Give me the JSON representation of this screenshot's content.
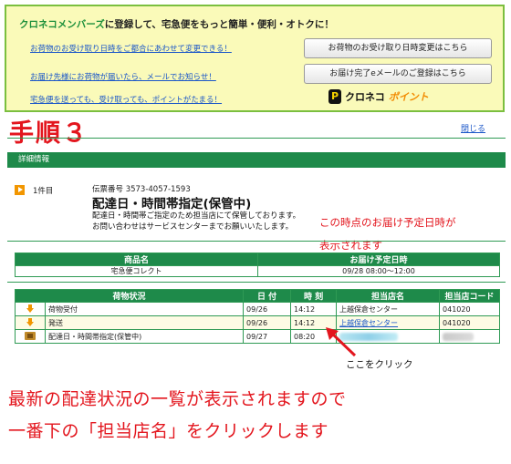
{
  "promo": {
    "heading_brand": "クロネコメンバーズ",
    "heading_rest": "に登録して、宅急便をもっと簡単・便利・オトクに！",
    "links": [
      "お荷物のお受け取り日時をご都合にあわせて変更できる！",
      "お届け先様にお荷物が届いたら、メールでお知らせ！",
      "宅急便を送っても、受け取っても、ポイントがたまる！"
    ],
    "buttons": [
      "お荷物のお受け取り日時変更はこちら",
      "お届け完了eメールのご登録はこちら"
    ],
    "logo_badge": "P",
    "logo_text": "クロネコ",
    "logo_point": "ポイント"
  },
  "step_title": "手順３",
  "close_link": "閉じる",
  "detail_header": "詳細情報",
  "item": {
    "count": "1件目",
    "slip": "伝票番号 3573-4057-1593",
    "status": "配達日・時間帯指定(保管中)",
    "note1": "配達日・時間帯ご指定のため担当店にて保管しております。",
    "note2": "お問い合わせはサービスセンターまでお願いいたします。"
  },
  "annotation_top_lines": [
    "この時点のお届け予定日時が",
    "表示されます"
  ],
  "goods_table": {
    "headers": [
      "商品名",
      "お届け予定日時"
    ],
    "row": [
      "宅急便コレクト",
      "09/28  08:00～12:00"
    ]
  },
  "status_table": {
    "headers": [
      "荷物状況",
      "日 付",
      "時 刻",
      "担当店名",
      "担当店コード"
    ],
    "rows": [
      {
        "status": "荷物受付",
        "date": "09/26",
        "time": "14:12",
        "store": "上越保倉センター",
        "code": "041020"
      },
      {
        "status": "発送",
        "date": "09/26",
        "time": "14:12",
        "store": "上越保倉センター",
        "code": "041020"
      },
      {
        "status": "配達日・時間帯指定(保管中)",
        "date": "09/27",
        "time": "08:20",
        "store": "",
        "code": ""
      }
    ]
  },
  "click_here": "ここをクリック",
  "bottom_notes": [
    "最新の配達状況の一覧が表示されますので",
    "一番下の「担当店名」をクリックします"
  ],
  "colors": {
    "green": "#1e8a4a",
    "red": "#e3161e",
    "panel": "#fafab9",
    "orange": "#f29600"
  }
}
